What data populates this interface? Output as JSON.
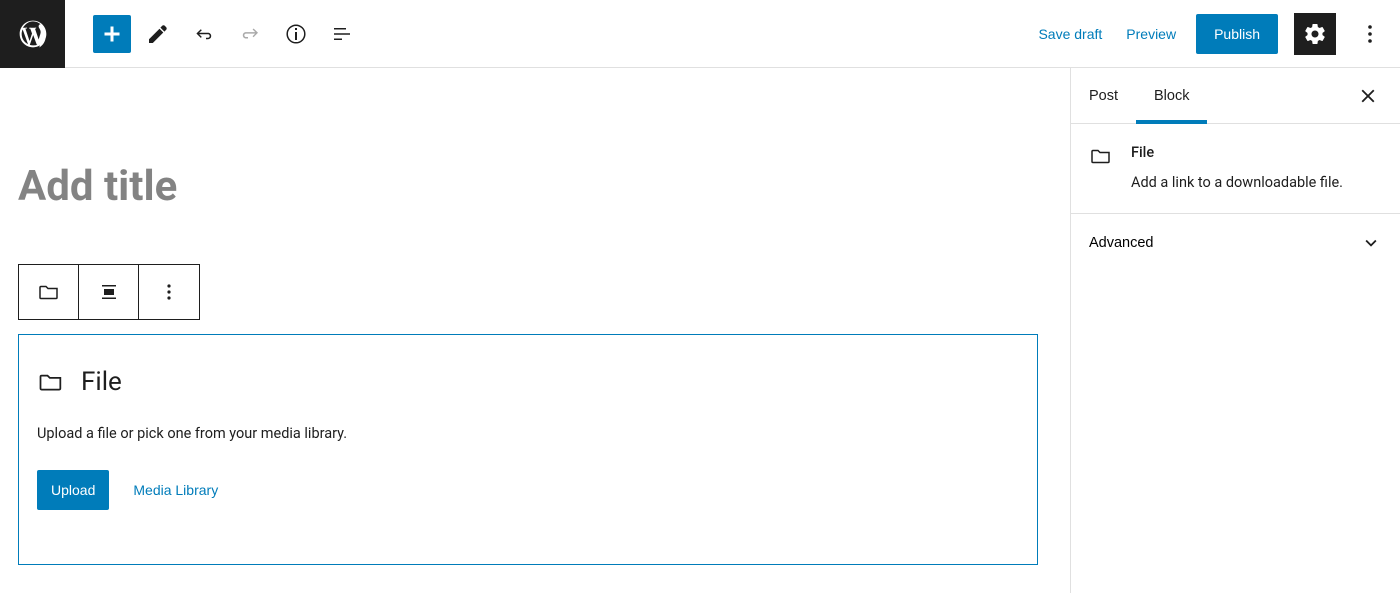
{
  "toolbar": {
    "save_draft": "Save draft",
    "preview": "Preview",
    "publish": "Publish"
  },
  "editor": {
    "title_placeholder": "Add title"
  },
  "file_block": {
    "title": "File",
    "description": "Upload a file or pick one from your media library.",
    "upload_label": "Upload",
    "media_library_label": "Media Library"
  },
  "sidebar": {
    "tabs": {
      "post": "Post",
      "block": "Block"
    },
    "block_info": {
      "name": "File",
      "description": "Add a link to a downloadable file."
    },
    "advanced_label": "Advanced"
  }
}
